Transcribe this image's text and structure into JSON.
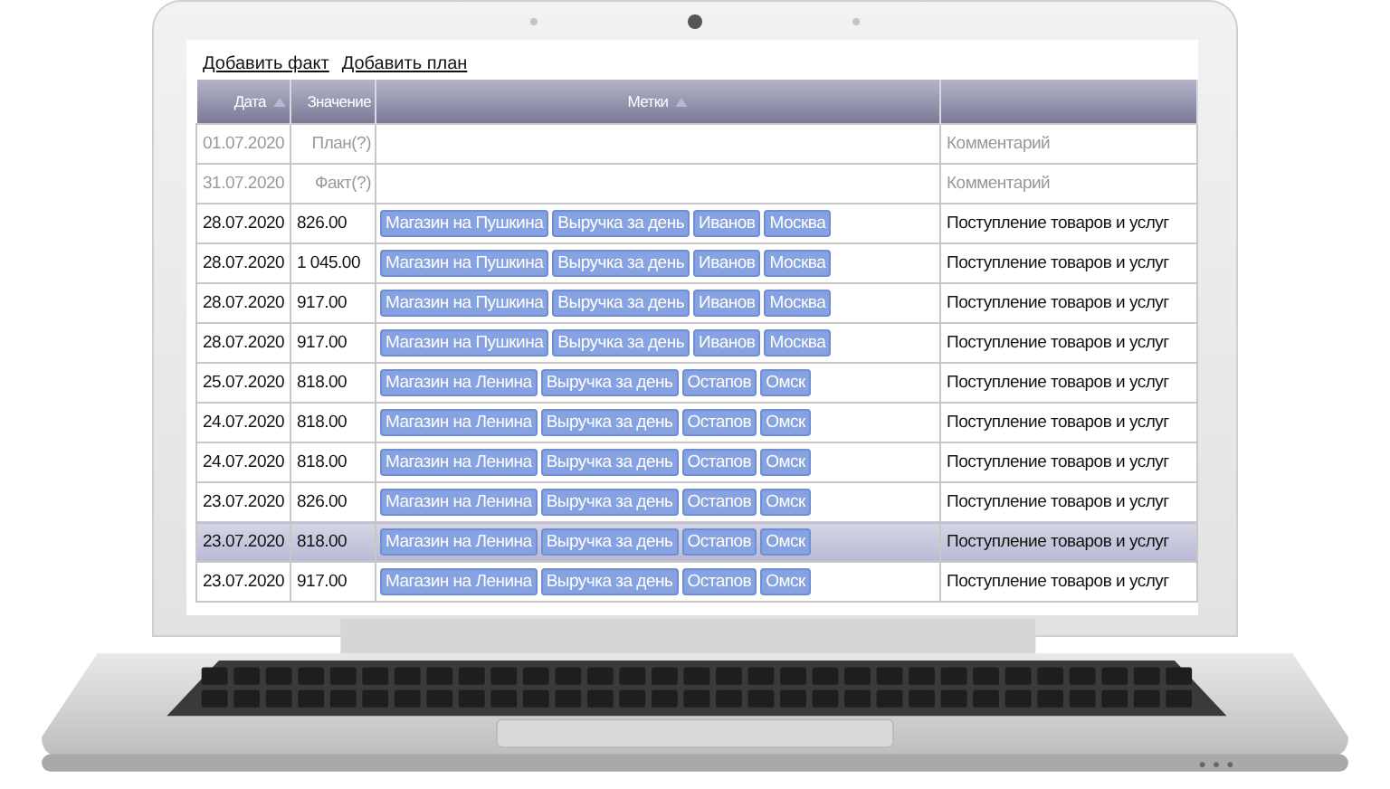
{
  "links": [
    "Добавить факт",
    "Добавить план"
  ],
  "table": {
    "columns": [
      {
        "label": "Дата",
        "sortable": true
      },
      {
        "label": "Значение",
        "sortable": false
      },
      {
        "label": "Метки",
        "sortable": true
      },
      {
        "sortable": false
      }
    ],
    "rows": [
      {
        "date": "01.07.2020",
        "value": "План(?)",
        "tags": [],
        "comment": "Комментарий",
        "disabled": true,
        "selected": false
      },
      {
        "date": "31.07.2020",
        "value": "Факт(?)",
        "tags": [],
        "comment": "Комментарий",
        "disabled": true,
        "selected": false
      },
      {
        "date": "28.07.2020",
        "value": "826.00",
        "tags": [
          "Магазин на Пушкина",
          "Выручка за день",
          "Иванов",
          "Москва"
        ],
        "comment": "Поступление товаров и услуг",
        "disabled": false,
        "selected": false
      },
      {
        "date": "28.07.2020",
        "value": "1 045.00",
        "tags": [
          "Магазин на Пушкина",
          "Выручка за день",
          "Иванов",
          "Москва"
        ],
        "comment": "Поступление товаров и услуг",
        "disabled": false,
        "selected": false
      },
      {
        "date": "28.07.2020",
        "value": "917.00",
        "tags": [
          "Магазин на Пушкина",
          "Выручка за день",
          "Иванов",
          "Москва"
        ],
        "comment": "Поступление товаров и услуг",
        "disabled": false,
        "selected": false
      },
      {
        "date": "28.07.2020",
        "value": "917.00",
        "tags": [
          "Магазин на Пушкина",
          "Выручка за день",
          "Иванов",
          "Москва"
        ],
        "comment": "Поступление товаров и услуг",
        "disabled": false,
        "selected": false
      },
      {
        "date": "25.07.2020",
        "value": "818.00",
        "tags": [
          "Магазин на Ленина",
          "Выручка за день",
          "Остапов",
          "Омск"
        ],
        "comment": "Поступление товаров и услуг",
        "disabled": false,
        "selected": false
      },
      {
        "date": "24.07.2020",
        "value": "818.00",
        "tags": [
          "Магазин на Ленина",
          "Выручка за день",
          "Остапов",
          "Омск"
        ],
        "comment": "Поступление товаров и услуг",
        "disabled": false,
        "selected": false
      },
      {
        "date": "24.07.2020",
        "value": "818.00",
        "tags": [
          "Магазин на Ленина",
          "Выручка за день",
          "Остапов",
          "Омск"
        ],
        "comment": "Поступление товаров и услуг",
        "disabled": false,
        "selected": false
      },
      {
        "date": "23.07.2020",
        "value": "826.00",
        "tags": [
          "Магазин на Ленина",
          "Выручка за день",
          "Остапов",
          "Омск"
        ],
        "comment": "Поступление товаров и услуг",
        "disabled": false,
        "selected": false
      },
      {
        "date": "23.07.2020",
        "value": "818.00",
        "tags": [
          "Магазин на Ленина",
          "Выручка за день",
          "Остапов",
          "Омск"
        ],
        "comment": "Поступление товаров и услуг",
        "disabled": false,
        "selected": true
      },
      {
        "date": "23.07.2020",
        "value": "917.00",
        "tags": [
          "Магазин на Ленина",
          "Выручка за день",
          "Остапов",
          "Омск"
        ],
        "comment": "Поступление товаров и услуг",
        "disabled": false,
        "selected": false
      }
    ]
  }
}
